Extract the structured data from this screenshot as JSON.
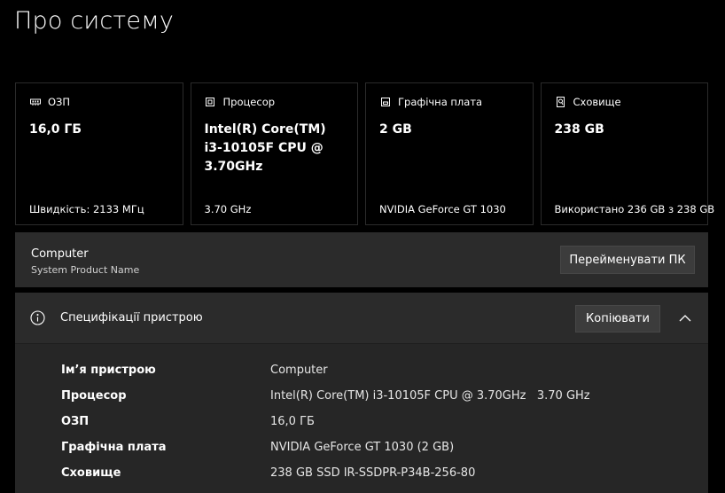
{
  "page": {
    "title": "Про систему"
  },
  "cards": [
    {
      "icon": "memory-icon",
      "label": "ОЗП",
      "value": "16,0 ГБ",
      "footer": "Швидкість: 2133 МГц"
    },
    {
      "icon": "processor-icon",
      "label": "Процесор",
      "value": "Intel(R) Core(TM) i3-10105F CPU @ 3.70GHz",
      "footer": "3.70 GHz"
    },
    {
      "icon": "graphics-card-icon",
      "label": "Графічна плата",
      "value": "2 GB",
      "footer": "NVIDIA GeForce GT 1030"
    },
    {
      "icon": "storage-icon",
      "label": "Сховище",
      "value": "238 GB",
      "footer": "Використано 236 GB з 238 GB"
    }
  ],
  "device": {
    "name": "Computer",
    "subtitle": "System Product Name",
    "rename_label": "Перейменувати ПК"
  },
  "specs": {
    "title": "Специфікації пристрою",
    "copy_label": "Копіювати",
    "rows": [
      {
        "label": "Ім’я пристрою",
        "value": "Computer"
      },
      {
        "label": "Процесор",
        "value": "Intel(R) Core(TM) i3-10105F CPU @ 3.70GHz   3.70 GHz"
      },
      {
        "label": "ОЗП",
        "value": "16,0 ГБ"
      },
      {
        "label": "Графічна плата",
        "value": "NVIDIA GeForce GT 1030 (2 GB)"
      },
      {
        "label": "Сховище",
        "value": "238 GB SSD IR-SSDPR-P34B-256-80"
      }
    ]
  },
  "colors": {
    "background": "#000000",
    "card_border": "#2b2b2b",
    "panel": "#2b2b2b",
    "button": "#3c3c3c"
  }
}
